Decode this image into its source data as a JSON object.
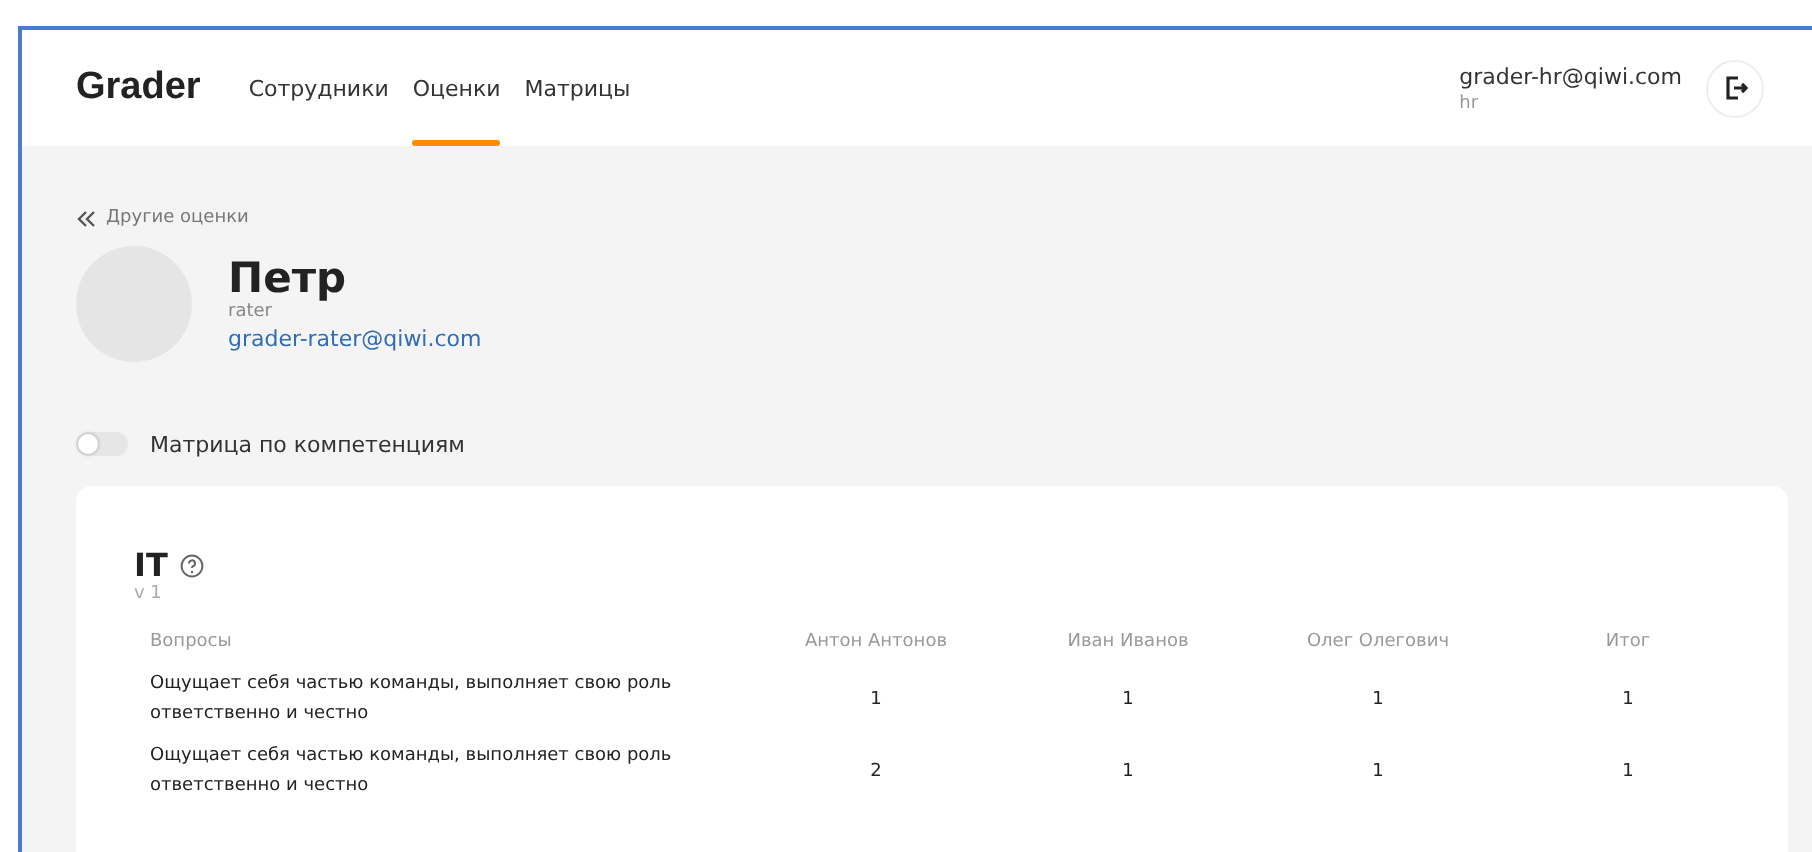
{
  "header": {
    "logo": "Grader",
    "nav": [
      {
        "label": "Сотрудники",
        "selected": false
      },
      {
        "label": "Оценки",
        "selected": true
      },
      {
        "label": "Матрицы",
        "selected": false
      }
    ],
    "user": {
      "email": "grader-hr@qiwi.com",
      "role": "hr"
    }
  },
  "back_link": "Другие оценки",
  "profile": {
    "name": "Петр",
    "role": "rater",
    "email": "grader-rater@qiwi.com"
  },
  "toggle": {
    "label": "Матрица по компетенциям",
    "on": false
  },
  "matrix": {
    "title": "IT",
    "version": "v 1",
    "table": {
      "columns": [
        "Вопросы",
        "Антон Антонов",
        "Иван Иванов",
        "Олег Олегович",
        "Итог"
      ],
      "rows": [
        {
          "question": "Ощущает себя частью команды, выполняет свою роль ответственно и честно",
          "scores": [
            "1",
            "1",
            "1",
            "1"
          ]
        },
        {
          "question": "Ощущает себя частью команды, выполняет свою роль ответственно и честно",
          "scores": [
            "2",
            "1",
            "1",
            "1"
          ]
        }
      ]
    }
  }
}
